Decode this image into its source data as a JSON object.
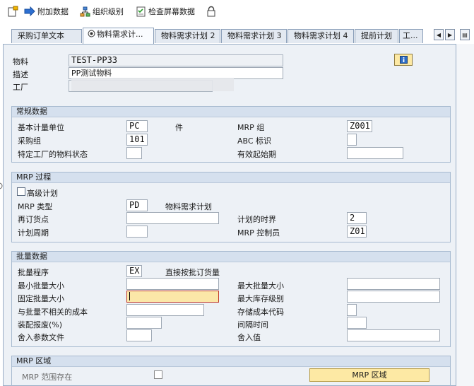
{
  "toolbar": {
    "append_data": "附加数据",
    "org_levels": "组织级别",
    "check_screen_data": "检查屏幕数据"
  },
  "tabs": {
    "t1": "采购订单文本",
    "t2": "物料需求计...",
    "t3": "物料需求计划 2",
    "t4": "物料需求计划 3",
    "t5": "物料需求计划 4",
    "t6": "提前计划",
    "t7": "工..."
  },
  "header": {
    "material_label": "物料",
    "material_value": "TEST-PP33",
    "desc_label": "描述",
    "desc_value": "PP测试物料",
    "plant_label": "工厂"
  },
  "general": {
    "title": "常规数据",
    "base_uom_label": "基本计量单位",
    "base_uom_value": "PC",
    "base_uom_text": "件",
    "mrp_group_label": "MRP 组",
    "mrp_group_value": "Z001",
    "purch_group_label": "采购组",
    "purch_group_value": "101",
    "abc_label": "ABC 标识",
    "plant_status_label": "特定工厂的物料状态",
    "valid_from_label": "有效起始期"
  },
  "mrp_proc": {
    "title": "MRP 过程",
    "mixed_mrp_label": "高级计划",
    "mrp_type_label": "MRP 类型",
    "mrp_type_value": "PD",
    "mrp_type_text": "物料需求计划",
    "reorder_label": "再订货点",
    "plan_fence_label": "计划的时界",
    "plan_fence_value": "2",
    "plan_cycle_label": "计划周期",
    "controller_label": "MRP 控制员",
    "controller_value": "Z01"
  },
  "lot": {
    "title": "批量数据",
    "lot_proc_label": "批量程序",
    "lot_proc_value": "EX",
    "lot_proc_text": "直接按批订货量",
    "min_lot_label": "最小批量大小",
    "max_lot_label": "最大批量大小",
    "fixed_lot_label": "固定批量大小",
    "max_stock_label": "最大库存级别",
    "ordering_cost_label": "与批量不相关的成本",
    "storage_cost_label": "存储成本代码",
    "assembly_scrap_label": "装配报废(%)",
    "takt_time_label": "间隔时间",
    "rounding_profile_label": "舍入参数文件",
    "rounding_value_label": "舍入值"
  },
  "mrp_area": {
    "title": "MRP 区域",
    "exists_label": "MRP  范围存在",
    "button_label": "MRP 区域"
  }
}
